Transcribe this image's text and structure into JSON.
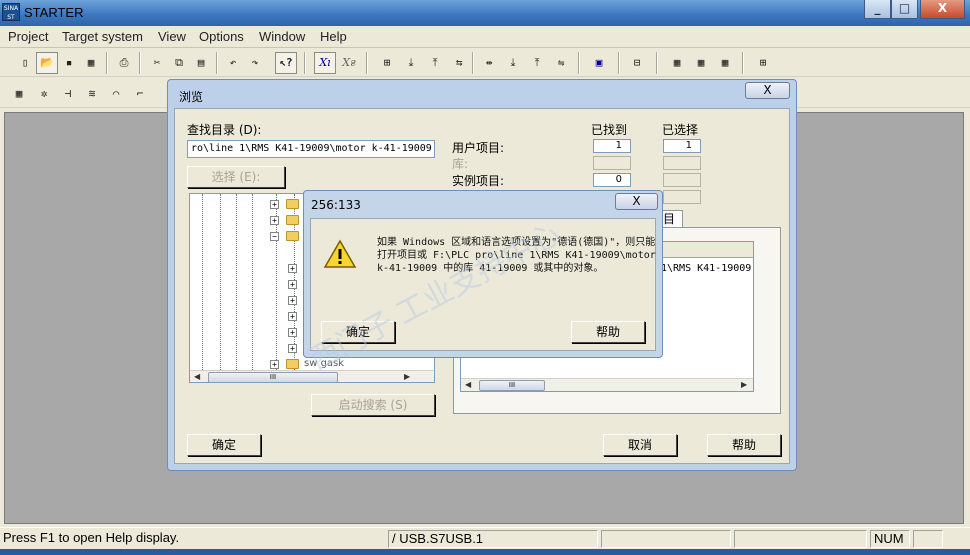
{
  "window": {
    "title": "STARTER",
    "icon_text": "SINA ST",
    "controls": [
      "_",
      "□",
      "X"
    ]
  },
  "menu": [
    "Project",
    "Target system",
    "View",
    "Options",
    "Window",
    "Help"
  ],
  "toolbar1": {
    "icons": [
      "new-icon",
      "open-icon",
      "save-icon",
      "save-compile-icon",
      "print-icon",
      "cut-icon",
      "copy-icon",
      "paste-icon",
      "undo-icon",
      "redo-icon",
      "context-help-icon",
      "expert-list-icon",
      "expert-list-alt-icon",
      "connect-icon",
      "download-icon",
      "upload-icon",
      "compare-icon",
      "split-icon",
      "target-download-icon",
      "target-upload-icon",
      "target-compare-icon",
      "accessible-nodes-icon",
      "project-navigator-icon",
      "device-config-icon",
      "view-1-icon",
      "view-2-icon",
      "view-3-icon",
      "network-icon"
    ]
  },
  "toolbar2": {
    "icons": [
      "grid-icon",
      "gear-icon",
      "io-icon",
      "wave-icon",
      "curve-icon",
      "trace-icon"
    ]
  },
  "browse_dialog": {
    "title": "浏览",
    "close": "X",
    "search_dir_label": "查找目录 (D):",
    "search_dir_value": "ro\\line 1\\RMS K41-19009\\motor k-41-19009",
    "select_button": "选择 (E):",
    "found_header": "已找到",
    "selected_header": "已选择",
    "user_projects_label": "用户项目:",
    "user_projects_found": "1",
    "user_projects_selected": "1",
    "library_label": "库:",
    "example_projects_label": "实例项目:",
    "example_projects_found": "0",
    "tab_fragment": "目",
    "list_text": "1\\RMS K41-19009",
    "start_search_button": "启动搜索 (S)",
    "ok_button": "确定",
    "cancel_button": "取消",
    "help_button": "帮助",
    "tree_partial_text": "sw gask",
    "scroll_thumb": "III"
  },
  "message_box": {
    "title": "256:133",
    "close": "X",
    "message": "如果 Windows 区域和语言选项设置为\"德语(德国)\"，则只能打开项目或 F:\\PLC pro\\line 1\\RMS K41-19009\\motor k-41-19009 中的库 41-19009 或其中的对象。",
    "ok_button": "确定",
    "help_button": "帮助"
  },
  "status_bar": {
    "help_text": "Press F1 to open Help display.",
    "interface": "/ USB.S7USB.1",
    "num": "NUM"
  }
}
